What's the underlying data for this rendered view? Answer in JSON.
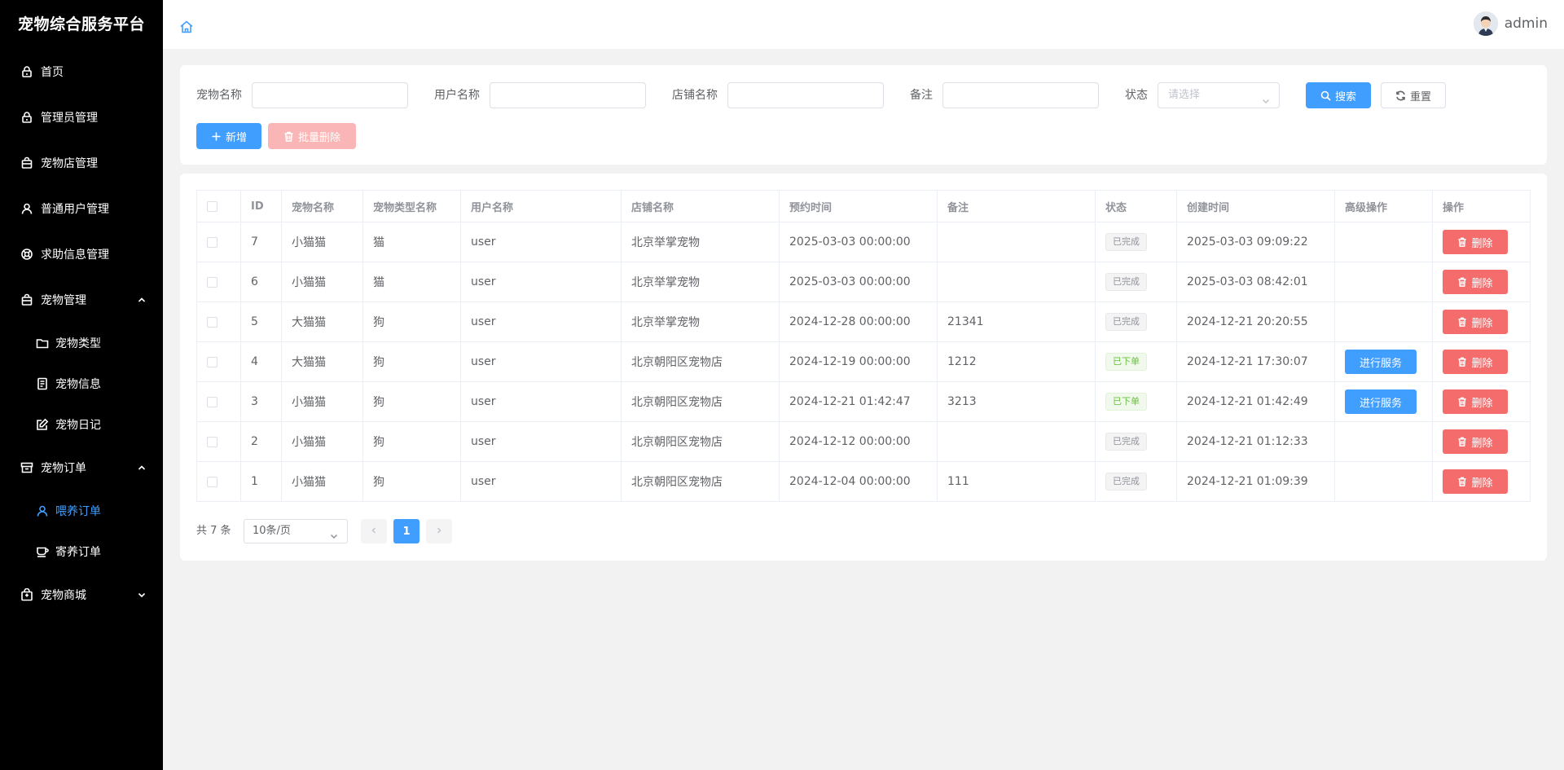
{
  "app": {
    "title": "宠物综合服务平台"
  },
  "sidebar": {
    "items": [
      {
        "label": "首页",
        "icon": "lock-icon"
      },
      {
        "label": "管理员管理",
        "icon": "lock-icon"
      },
      {
        "label": "宠物店管理",
        "icon": "shopping-bag-icon"
      },
      {
        "label": "普通用户管理",
        "icon": "user-icon"
      },
      {
        "label": "求助信息管理",
        "icon": "lifebuoy-icon"
      },
      {
        "label": "宠物管理",
        "icon": "shopping-bag-icon",
        "expanded": true,
        "children": [
          {
            "label": "宠物类型",
            "icon": "folder-icon"
          },
          {
            "label": "宠物信息",
            "icon": "document-icon"
          },
          {
            "label": "宠物日记",
            "icon": "edit-icon"
          }
        ]
      },
      {
        "label": "宠物订单",
        "icon": "box-icon",
        "expanded": true,
        "children": [
          {
            "label": "喂养订单",
            "icon": "user-icon",
            "active": true
          },
          {
            "label": "寄养订单",
            "icon": "cup-icon"
          }
        ]
      },
      {
        "label": "宠物商城",
        "icon": "shop-icon",
        "expanded": false
      }
    ]
  },
  "header": {
    "username": "admin"
  },
  "search": {
    "pet_name_label": "宠物名称",
    "user_name_label": "用户名称",
    "shop_name_label": "店铺名称",
    "remark_label": "备注",
    "status_label": "状态",
    "status_placeholder": "请选择",
    "search_button": "搜索",
    "reset_button": "重置",
    "add_button": "新增",
    "batch_delete_button": "批量删除"
  },
  "table": {
    "columns": [
      "ID",
      "宠物名称",
      "宠物类型名称",
      "用户名称",
      "店铺名称",
      "预约时间",
      "备注",
      "状态",
      "创建时间",
      "高级操作",
      "操作"
    ],
    "rows": [
      {
        "id": "7",
        "pet_name": "小猫猫",
        "pet_type": "猫",
        "user": "user",
        "shop": "北京举掌宠物",
        "appointment": "2025-03-03 00:00:00",
        "remark": "",
        "status": "已完成",
        "status_kind": "done",
        "created": "2025-03-03 09:09:22",
        "advanced": "",
        "action": "删除"
      },
      {
        "id": "6",
        "pet_name": "小猫猫",
        "pet_type": "猫",
        "user": "user",
        "shop": "北京举掌宠物",
        "appointment": "2025-03-03 00:00:00",
        "remark": "",
        "status": "已完成",
        "status_kind": "done",
        "created": "2025-03-03 08:42:01",
        "advanced": "",
        "action": "删除"
      },
      {
        "id": "5",
        "pet_name": "大猫猫",
        "pet_type": "狗",
        "user": "user",
        "shop": "北京举掌宠物",
        "appointment": "2024-12-28 00:00:00",
        "remark": "21341",
        "status": "已完成",
        "status_kind": "done",
        "created": "2024-12-21 20:20:55",
        "advanced": "",
        "action": "删除"
      },
      {
        "id": "4",
        "pet_name": "大猫猫",
        "pet_type": "狗",
        "user": "user",
        "shop": "北京朝阳区宠物店",
        "appointment": "2024-12-19 00:00:00",
        "remark": "1212",
        "status": "已下单",
        "status_kind": "ordered",
        "created": "2024-12-21 17:30:07",
        "advanced": "进行服务",
        "action": "删除"
      },
      {
        "id": "3",
        "pet_name": "小猫猫",
        "pet_type": "狗",
        "user": "user",
        "shop": "北京朝阳区宠物店",
        "appointment": "2024-12-21 01:42:47",
        "remark": "3213",
        "status": "已下单",
        "status_kind": "ordered",
        "created": "2024-12-21 01:42:49",
        "advanced": "进行服务",
        "action": "删除"
      },
      {
        "id": "2",
        "pet_name": "小猫猫",
        "pet_type": "狗",
        "user": "user",
        "shop": "北京朝阳区宠物店",
        "appointment": "2024-12-12 00:00:00",
        "remark": "",
        "status": "已完成",
        "status_kind": "done",
        "created": "2024-12-21 01:12:33",
        "advanced": "",
        "action": "删除"
      },
      {
        "id": "1",
        "pet_name": "小猫猫",
        "pet_type": "狗",
        "user": "user",
        "shop": "北京朝阳区宠物店",
        "appointment": "2024-12-04 00:00:00",
        "remark": "111",
        "status": "已完成",
        "status_kind": "done",
        "created": "2024-12-21 01:09:39",
        "advanced": "",
        "action": "删除"
      }
    ]
  },
  "pagination": {
    "total_text": "共 7 条",
    "page_size": "10条/页",
    "current_page": "1"
  },
  "colors": {
    "primary": "#409eff",
    "danger": "#f56c6c",
    "sidebar_bg": "#000000",
    "success": "#67c23a"
  }
}
